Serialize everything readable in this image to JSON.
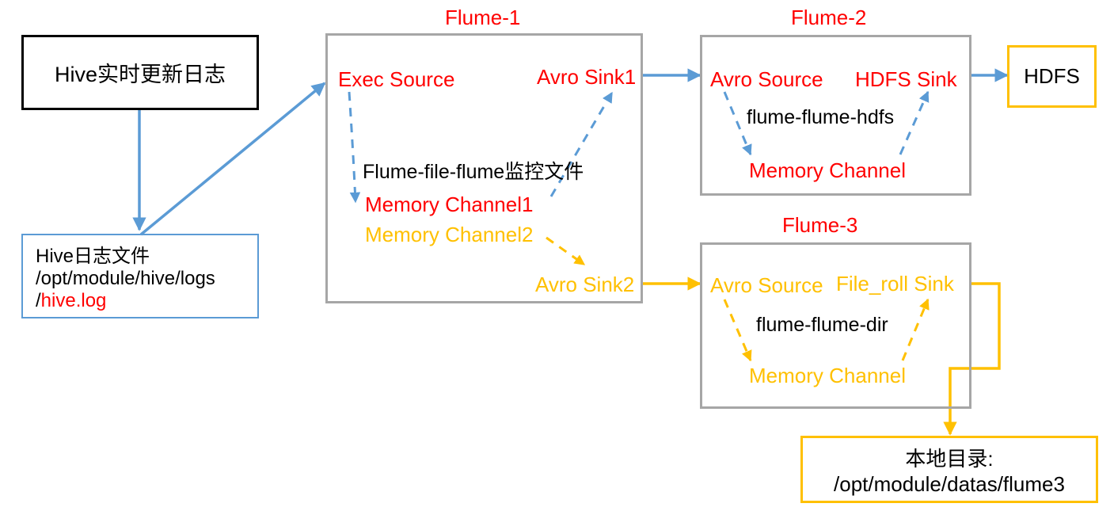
{
  "diagram": {
    "title_color_red": "#ff0000",
    "color_orange": "#ffc000",
    "color_blue": "#5b9bd5",
    "color_gray": "#a6a6a6",
    "color_black": "#000000"
  },
  "source_box": {
    "label": "Hive实时更新日志"
  },
  "log_file_box": {
    "line1": "Hive日志文件",
    "line2": "/opt/module/hive/logs",
    "line3_prefix": "/",
    "line3_file": "hive.log"
  },
  "flume1": {
    "title": "Flume-1",
    "source": "Exec Source",
    "sink1": "Avro Sink1",
    "config": "Flume-file-flume监控文件",
    "channel1": "Memory  Channel1",
    "channel2": "Memory  Channel2",
    "sink2": "Avro Sink2"
  },
  "flume2": {
    "title": "Flume-2",
    "source": "Avro Source",
    "sink": "HDFS Sink",
    "config": "flume-flume-hdfs",
    "channel": "Memory Channel"
  },
  "flume3": {
    "title": "Flume-3",
    "source": "Avro Source",
    "sink": "File_roll Sink",
    "config": "flume-flume-dir",
    "channel": "Memory Channel"
  },
  "hdfs_box": {
    "label": "HDFS"
  },
  "local_dir_box": {
    "line1": "本地目录:",
    "line2": "/opt/module/datas/flume3"
  }
}
